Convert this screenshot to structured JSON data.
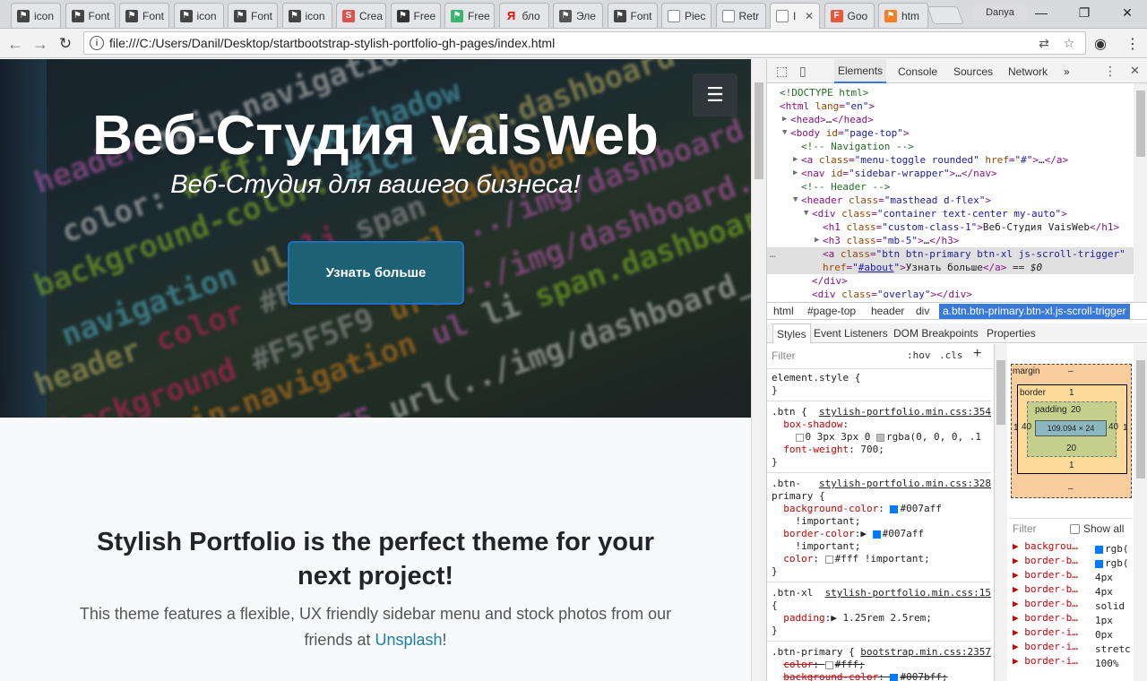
{
  "browser": {
    "tabs": [
      {
        "title": "icon",
        "fav": "flag-icon",
        "color": "#444"
      },
      {
        "title": "Font",
        "fav": "flag-icon",
        "color": "#444"
      },
      {
        "title": "Font",
        "fav": "flag-icon",
        "color": "#444"
      },
      {
        "title": "icon",
        "fav": "flag-icon",
        "color": "#444"
      },
      {
        "title": "Font",
        "fav": "flag-icon",
        "color": "#444"
      },
      {
        "title": "icon",
        "fav": "flag-icon",
        "color": "#444"
      },
      {
        "title": "Crea",
        "fav": "s-icon",
        "color": "#d9534f"
      },
      {
        "title": "Free",
        "fav": "swirl-icon",
        "color": "#333"
      },
      {
        "title": "Free",
        "fav": "leaf-icon",
        "color": "#3cb371"
      },
      {
        "title": "бло",
        "fav": "yandex-icon",
        "color": "#ff0000"
      },
      {
        "title": "Эле",
        "fav": "monitor-icon",
        "color": "#555"
      },
      {
        "title": "Font",
        "fav": "flag-icon",
        "color": "#444"
      },
      {
        "title": "Piec",
        "fav": "page-icon",
        "color": "#777"
      },
      {
        "title": "Retr",
        "fav": "page-icon",
        "color": "#777"
      },
      {
        "title": "I",
        "fav": "page-icon",
        "color": "#777",
        "active": true
      },
      {
        "title": "Goo",
        "fav": "f-icon",
        "color": "#e8583e"
      },
      {
        "title": "htm",
        "fav": "stack-icon",
        "color": "#f48024"
      }
    ],
    "profile_name": "Danya",
    "url": "file:///C:/Users/Danil/Desktop/startbootstrap-stylish-portfolio-gh-pages/index.html",
    "window_controls": {
      "minimize": "—",
      "restore": "❐",
      "close": "✕"
    }
  },
  "page": {
    "hero_title": "Веб-Студия VaisWeb",
    "hero_subtitle": "Веб-Студия для вашего бизнеса!",
    "hero_button": "Узнать больше",
    "menu_icon": "☰",
    "about_heading": "Stylish Portfolio is the perfect theme for your next project!",
    "about_text_before": "This theme features a flexible, UX friendly sidebar menu and stock photos from our friends at ",
    "about_link": "Unsplash",
    "about_text_after": "!",
    "code_lines": [
      "header main-navigation ul li",
      "color: #fff; box-shadow",
      "background-color: #1c2 span.dashboard",
      "navigation ul li span dashboard",
      "header color #FSFSFS url ../img/dashboard.hover",
      "background #F5F5F9 url ../img/dashboard.png",
      "header main-navigation ul li span.dashboard",
      "background #F5F5F5 url(../img/dashboard_active.png"
    ]
  },
  "devtools": {
    "tabs": [
      "Elements",
      "Console",
      "Sources",
      "Network",
      "»"
    ],
    "active_tab": "Elements",
    "dom_lines": [
      {
        "indent": 0,
        "arrow": "",
        "html": "<span class='cmt'>&lt;!DOCTYPE html&gt;</span>"
      },
      {
        "indent": 0,
        "arrow": "",
        "html": "<span class='tag'>&lt;html</span> <span class='attr'>lang</span>=<span class='val'>\"en\"</span><span class='tag'>&gt;</span>"
      },
      {
        "indent": 1,
        "arrow": "▶",
        "html": "<span class='tag'>&lt;head&gt;</span><span class='txt'>…</span><span class='tag'>&lt;/head&gt;</span>"
      },
      {
        "indent": 1,
        "arrow": "▼",
        "html": "<span class='tag'>&lt;body</span> <span class='attr'>id</span>=<span class='val'>\"page-top\"</span><span class='tag'>&gt;</span>"
      },
      {
        "indent": 2,
        "arrow": "",
        "html": "<span class='cmt'>&lt;!-- Navigation --&gt;</span>"
      },
      {
        "indent": 2,
        "arrow": "▶",
        "html": "<span class='tag'>&lt;a</span> <span class='attr'>class</span>=<span class='val'>\"menu-toggle rounded\"</span> <span class='attr'>href</span>=<span class='val'>\"#\"</span><span class='tag'>&gt;</span><span class='txt'>…</span><span class='tag'>&lt;/a&gt;</span>"
      },
      {
        "indent": 2,
        "arrow": "▶",
        "html": "<span class='tag'>&lt;nav</span> <span class='attr'>id</span>=<span class='val'>\"sidebar-wrapper\"</span><span class='tag'>&gt;</span><span class='txt'>…</span><span class='tag'>&lt;/nav&gt;</span>"
      },
      {
        "indent": 2,
        "arrow": "",
        "html": "<span class='cmt'>&lt;!-- Header --&gt;</span>"
      },
      {
        "indent": 2,
        "arrow": "▼",
        "html": "<span class='tag'>&lt;header</span> <span class='attr'>class</span>=<span class='val'>\"masthead d-flex\"</span><span class='tag'>&gt;</span>"
      },
      {
        "indent": 3,
        "arrow": "▼",
        "html": "<span class='tag'>&lt;div</span> <span class='attr'>class</span>=<span class='val'>\"container text-center my-auto\"</span><span class='tag'>&gt;</span>"
      },
      {
        "indent": 4,
        "arrow": "",
        "html": "<span class='tag'>&lt;h1</span> <span class='attr'>class</span>=<span class='val'>\"custom-class-1\"</span><span class='tag'>&gt;</span><span class='txt'>Веб-Студия VaisWeb</span><span class='tag'>&lt;/h1&gt;</span>"
      },
      {
        "indent": 4,
        "arrow": "▶",
        "html": "<span class='tag'>&lt;h3</span> <span class='attr'>class</span>=<span class='val'>\"mb-5\"</span><span class='tag'>&gt;</span><span class='txt'>…</span><span class='tag'>&lt;/h3&gt;</span>"
      },
      {
        "indent": 4,
        "arrow": "",
        "sel": true,
        "html": "<span class='tag'>&lt;a</span> <span class='attr'>class</span>=<span class='val'>\"btn btn-primary btn-xl js-scroll-trigger\"</span>"
      },
      {
        "indent": 4,
        "arrow": "",
        "sel": true,
        "html": "<span class='attr'>href</span>=<span class='val'>\"<u>#about</u>\"</span><span class='tag'>&gt;</span><span class='txt'>Узнать больше</span><span class='tag'>&lt;/a&gt;</span> <span class='txt'>== <i>$0</i></span>"
      },
      {
        "indent": 3,
        "arrow": "",
        "html": "<span class='tag'>&lt;/div&gt;</span>"
      },
      {
        "indent": 3,
        "arrow": "",
        "html": "<span class='tag'>&lt;div</span> <span class='attr'>class</span>=<span class='val'>\"overlay\"</span><span class='tag'>&gt;&lt;/div&gt;</span>"
      }
    ],
    "breadcrumbs": [
      "html",
      "#page-top",
      "header",
      "div",
      "a.btn.btn-primary.btn-xl.js-scroll-trigger"
    ],
    "subtabs": [
      "Styles",
      "Event Listeners",
      "DOM Breakpoints",
      "Properties"
    ],
    "filter_placeholder": "Filter",
    "hov": ":hov",
    "cls": ".cls",
    "style_rules": [
      {
        "lines": [
          "element.style {",
          "}"
        ]
      },
      {
        "src": "stylish-portfolio.min.css:354",
        "lines": [
          ".btn {",
          "  <span class='prop'>box-shadow</span>:",
          "    <span class='sw' style='background:#fff'></span>0 3px 3px 0 <span class='sw' style='background:#bbb'></span>rgba(0, 0, 0, .1",
          "  <span class='prop'>font-weight</span>: 700;",
          "}"
        ]
      },
      {
        "src": "stylish-portfolio.min.css:328",
        "lines": [
          ".btn-",
          "primary {",
          "  <span class='prop'>background-color</span>: <span class='sw' style='background:#007aff;border-color:#007aff'></span>#007aff",
          "    !important;",
          "  <span class='prop'>border-color</span>:▶ <span class='sw' style='background:#007aff;border-color:#007aff'></span>#007aff",
          "    !important;",
          "  <span class='prop'>color</span>: <span class='sw' style='background:#fff'></span>#fff !important;",
          "}"
        ]
      },
      {
        "src": "stylish-portfolio.min.css:15",
        "lines": [
          ".btn-xl",
          "{",
          "  <span class='prop'>padding</span>:▶ 1.25rem 2.5rem;",
          "}"
        ]
      },
      {
        "src": "bootstrap.min.css:2357",
        "lines": [
          ".btn-primary {",
          "  <span class='prop strike'>color</span><span class='strike'>: <span class='sw' style='background:#fff'></span>#fff;</span>",
          "  <span class='prop strike'>background-color</span><span class='strike'>: <span class='sw' style='background:#007bff;border-color:#007bff'></span>#007bff;</span>"
        ]
      }
    ],
    "box_model": {
      "margin_label": "margin",
      "margin": "–",
      "border_label": "border",
      "border": "1",
      "padding_label": "padding",
      "padding": "20",
      "content": "109.094 × 24",
      "side": "40",
      "border_side": "1"
    },
    "computed_filter": "Filter",
    "show_all": "Show all",
    "computed": [
      {
        "prop": "backgrou…",
        "swatch": "#007aff",
        "val": "rgb("
      },
      {
        "prop": "border-b…",
        "swatch": "#007aff",
        "val": "rgb("
      },
      {
        "prop": "border-b…",
        "val": "4px"
      },
      {
        "prop": "border-b…",
        "val": "4px"
      },
      {
        "prop": "border-b…",
        "val": "solid"
      },
      {
        "prop": "border-b…",
        "val": "1px"
      },
      {
        "prop": "border-i…",
        "val": "0px"
      },
      {
        "prop": "border-i…",
        "val": "stretc"
      },
      {
        "prop": "border-i…",
        "val": "100%"
      }
    ]
  }
}
